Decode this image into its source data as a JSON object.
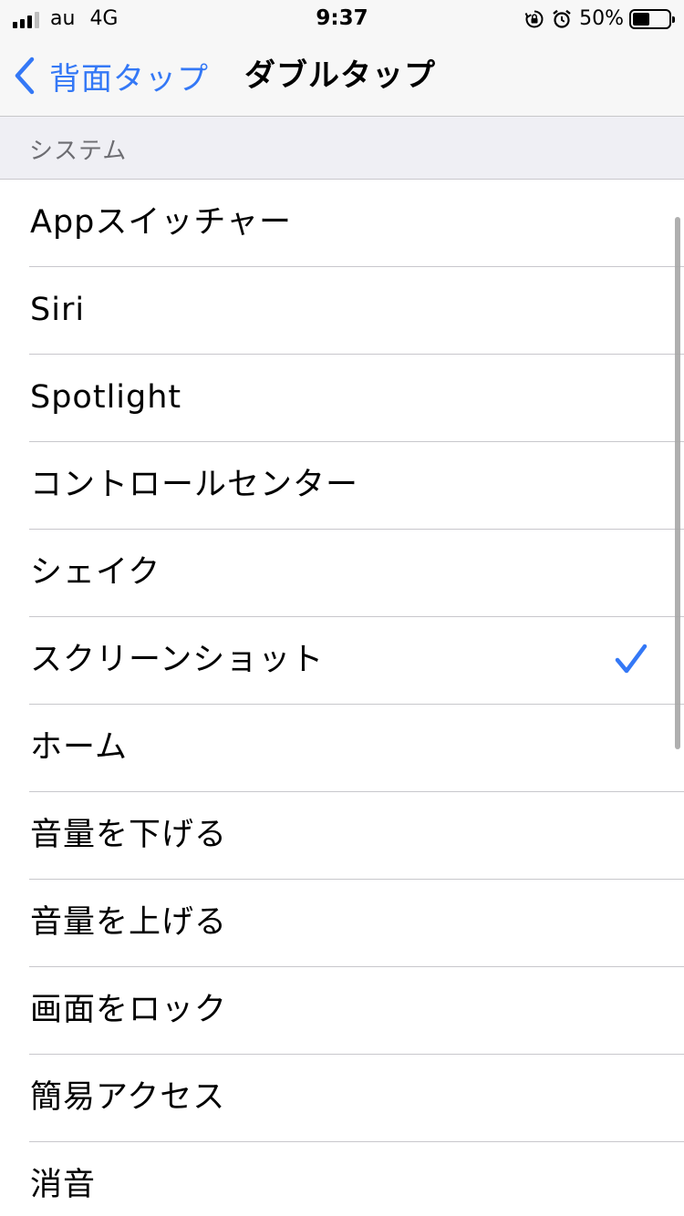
{
  "status_bar": {
    "carrier": "au",
    "network": "4G",
    "time": "9:37",
    "battery_percent": "50%",
    "battery_level": 0.5
  },
  "nav": {
    "back_label": "背面タップ",
    "title": "ダブルタップ",
    "accent_color": "#3478f6"
  },
  "section": {
    "header": "システム"
  },
  "items": [
    {
      "label": "Appスイッチャー",
      "selected": false
    },
    {
      "label": "Siri",
      "selected": false
    },
    {
      "label": "Spotlight",
      "selected": false
    },
    {
      "label": "コントロールセンター",
      "selected": false
    },
    {
      "label": "シェイク",
      "selected": false
    },
    {
      "label": "スクリーンショット",
      "selected": true
    },
    {
      "label": "ホーム",
      "selected": false
    },
    {
      "label": "音量を下げる",
      "selected": false
    },
    {
      "label": "音量を上げる",
      "selected": false
    },
    {
      "label": "画面をロック",
      "selected": false
    },
    {
      "label": "簡易アクセス",
      "selected": false
    },
    {
      "label": "消音",
      "selected": false
    }
  ]
}
